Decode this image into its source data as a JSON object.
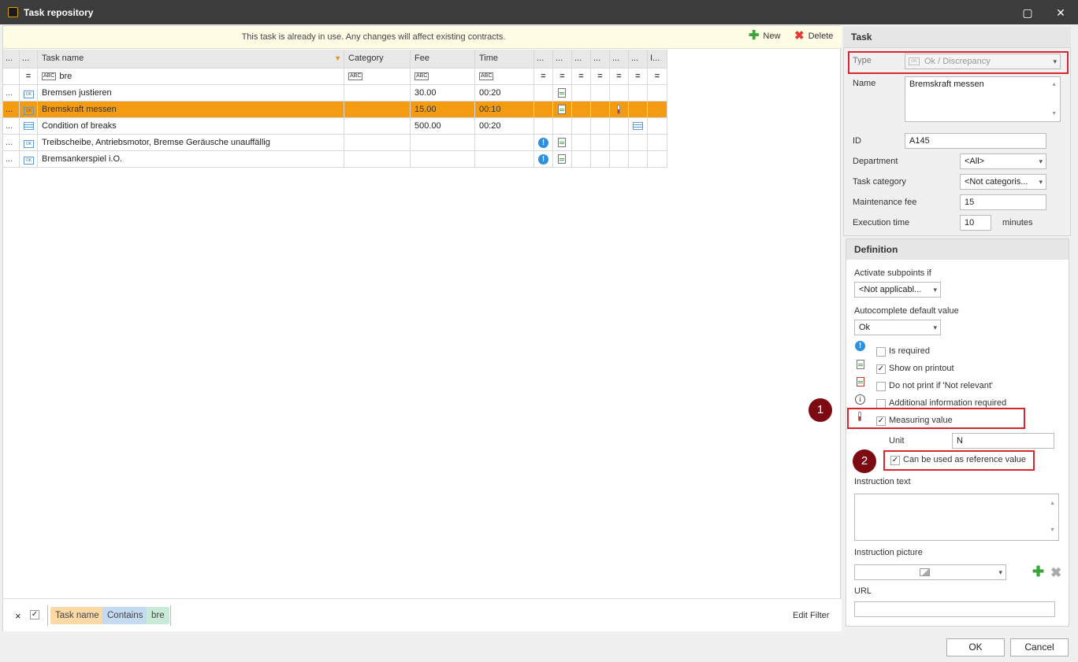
{
  "window": {
    "title": "Task repository"
  },
  "banner": {
    "message": "This task is already in use. Any changes will affect existing contracts.",
    "new_label": "New",
    "delete_label": "Delete"
  },
  "grid": {
    "headers": {
      "dots1": "...",
      "dots2": "...",
      "task_name": "Task name",
      "category": "Category",
      "fee": "Fee",
      "time": "Time",
      "c1": "...",
      "c2": "...",
      "c3": "...",
      "c4": "...",
      "c5": "...",
      "c6": "...",
      "c7": "I..."
    },
    "filter": {
      "task_name": "bre"
    },
    "rows": [
      {
        "dots": "...",
        "icon": "ok-icon",
        "name": "Bremsen justieren",
        "category": "",
        "fee": "30.00",
        "time": "00:20",
        "printout": true,
        "required": false,
        "measure": false,
        "list": false
      },
      {
        "dots": "...",
        "icon": "ok-icon",
        "name": "Bremskraft messen",
        "category": "",
        "fee": "15.00",
        "time": "00:10",
        "printout": true,
        "required": false,
        "measure": true,
        "list": false,
        "selected": true
      },
      {
        "dots": "...",
        "icon": "list-icon",
        "name": "Condition of breaks",
        "category": "",
        "fee": "500.00",
        "time": "00:20",
        "printout": false,
        "required": false,
        "measure": false,
        "list": true
      },
      {
        "dots": "...",
        "icon": "ok-icon",
        "name": "Treibscheibe, Antriebsmotor, Bremse  Geräusche unauffällig",
        "category": "",
        "fee": "",
        "time": "",
        "printout": true,
        "required": true,
        "measure": false,
        "list": false
      },
      {
        "dots": "...",
        "icon": "ok-icon",
        "name": "Bremsankerspiel i.O.",
        "category": "",
        "fee": "",
        "time": "",
        "printout": true,
        "required": true,
        "measure": false,
        "list": false
      }
    ]
  },
  "filterbar": {
    "close": "×",
    "check": "✓",
    "chip_field": "Task name",
    "chip_op": "Contains",
    "chip_value": "bre",
    "edit_filter": "Edit Filter"
  },
  "task": {
    "header": "Task",
    "type_label": "Type",
    "type_value": "Ok / Discrepancy",
    "name_label": "Name",
    "name_value": "Bremskraft messen",
    "id_label": "ID",
    "id_value": "A145",
    "department_label": "Department",
    "department_value": "<All>",
    "category_label": "Task category",
    "category_value": "<Not categoris...",
    "fee_label": "Maintenance fee",
    "fee_value": "15",
    "time_label": "Execution time",
    "time_value": "10",
    "time_unit": "minutes"
  },
  "definition": {
    "header": "Definition",
    "subpoints_label": "Activate subpoints if",
    "subpoints_value": "<Not applicabl...",
    "autocomplete_label": "Autocomplete default value",
    "autocomplete_value": "Ok",
    "is_required": "Is required",
    "show_printout": "Show on printout",
    "no_print": "Do not print if 'Not relevant'",
    "additional_info": "Additional information required",
    "measuring_value": "Measuring value",
    "unit_label": "Unit",
    "unit_value": "N",
    "reference_value": "Can be used as reference value",
    "instruction_text_label": "Instruction text",
    "instruction_picture_label": "Instruction picture",
    "url_label": "URL"
  },
  "callouts": {
    "one": "1",
    "two": "2"
  },
  "footer": {
    "ok": "OK",
    "cancel": "Cancel"
  },
  "colors": {
    "selection": "#f39c12",
    "highlight": "#d9262c",
    "callout": "#7d0a12"
  }
}
